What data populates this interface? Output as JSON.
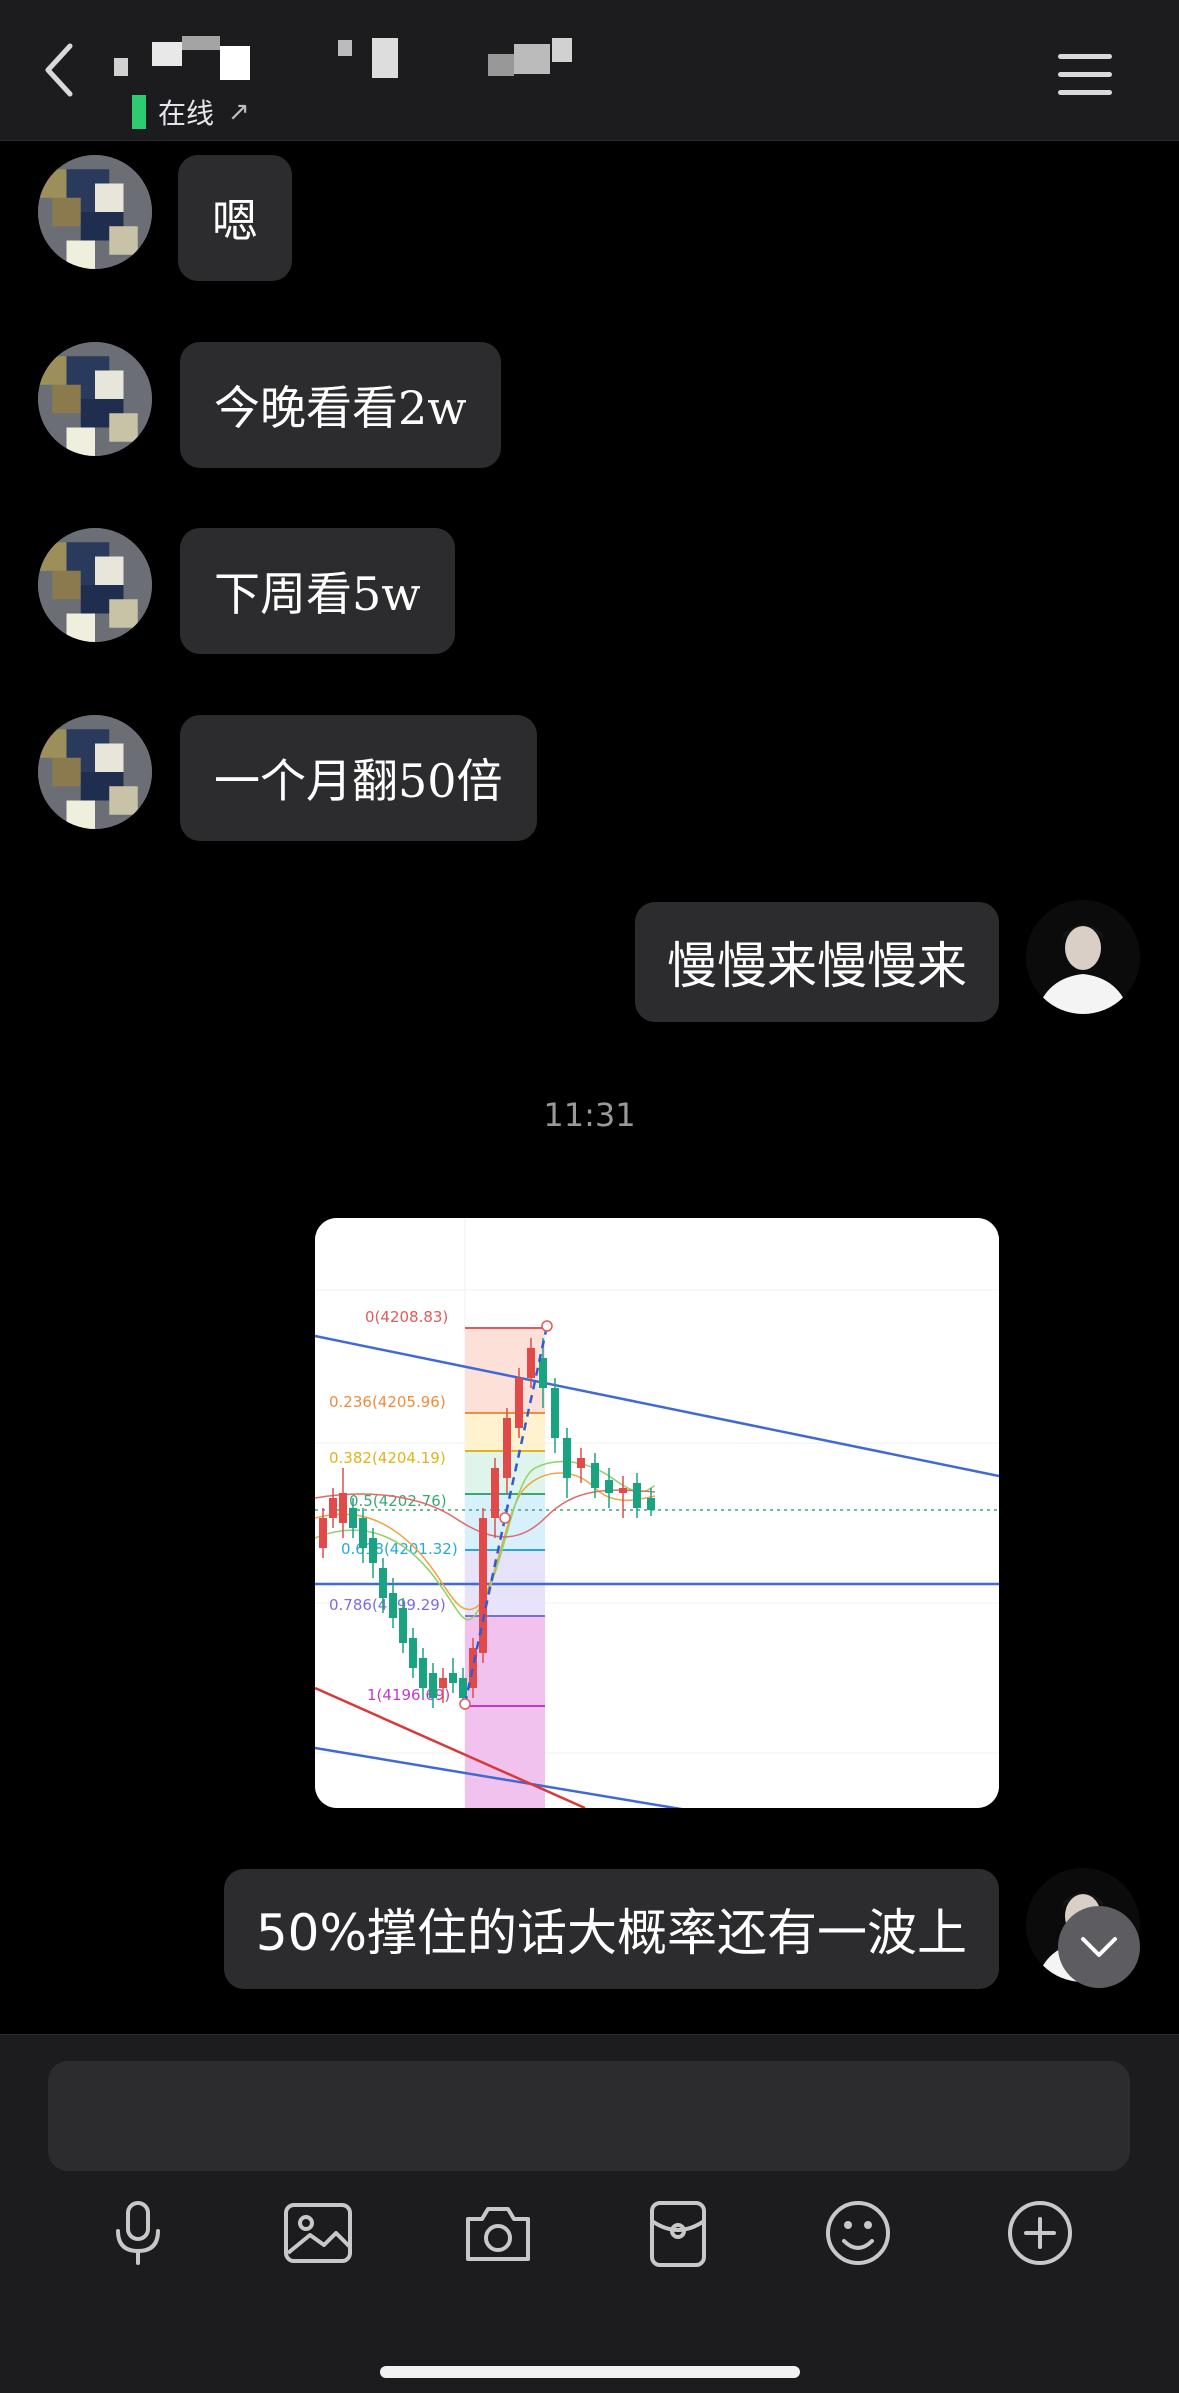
{
  "header": {
    "status_text": "在线",
    "status_arrow": "↗",
    "status_color": "#2ecc71"
  },
  "messages": [
    {
      "side": "in",
      "text": "嗯"
    },
    {
      "side": "in",
      "text": "今晚看看2w"
    },
    {
      "side": "in",
      "text": "下周看5w"
    },
    {
      "side": "in",
      "text": "一个月翻50倍"
    },
    {
      "side": "out",
      "text": "慢慢来慢慢来"
    }
  ],
  "timestamp": "11:31",
  "chart": {
    "fib_levels": [
      {
        "label": "0(4208.83)",
        "value": 4208.83,
        "color": "#e05b5b"
      },
      {
        "label": "0.236(4205.96)",
        "value": 4205.96,
        "color": "#f08c3c"
      },
      {
        "label": "0.382(4204.19)",
        "value": 4204.19,
        "color": "#e3b21b"
      },
      {
        "label": "0.5(4202.76)",
        "value": 4202.76,
        "color": "#3aa876"
      },
      {
        "label": "0.618(4201.32)",
        "value": 4201.32,
        "color": "#27a8d9"
      },
      {
        "label": "0.786(4199.29)",
        "value": 4199.29,
        "color": "#7b6fd6"
      },
      {
        "label": "1(4196.69)",
        "value": 4196.69,
        "color": "#c03ad0"
      }
    ]
  },
  "last_message": {
    "side": "out",
    "text": "50%撑住的话大概率还有一波上"
  },
  "input": {
    "placeholder": ""
  },
  "toolbar": {
    "icons": [
      "microphone-icon",
      "image-icon",
      "camera-icon",
      "red-packet-icon",
      "emoji-icon",
      "plus-icon"
    ]
  },
  "colors": {
    "bubble": "#2c2c2e",
    "background": "#000000",
    "bar": "#1c1c1e"
  }
}
